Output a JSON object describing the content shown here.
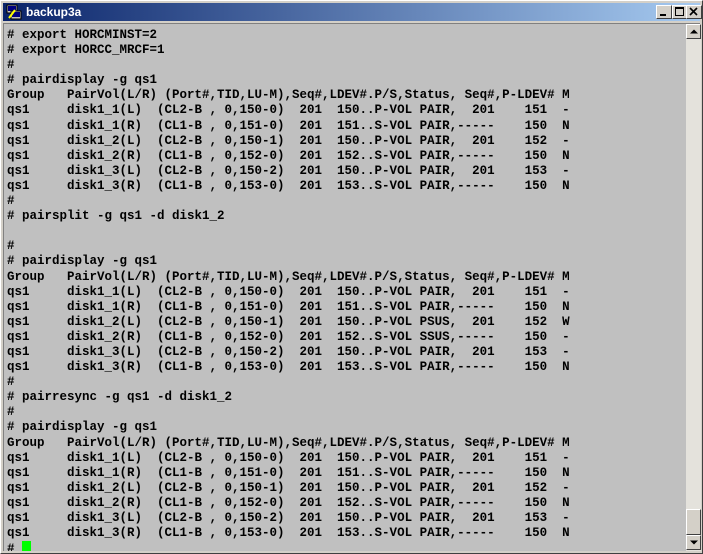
{
  "window": {
    "title": "backup3a",
    "app_icon": "putty-icon",
    "buttons": [
      "minimize-icon",
      "maximize-icon",
      "close-icon"
    ]
  },
  "terminal": {
    "background": "#c0c0c0",
    "foreground": "#000000",
    "cursor_color": "#00ff00",
    "lines": [
      "# export HORCMINST=2",
      "# export HORCC_MRCF=1",
      "#",
      "# pairdisplay -g qs1",
      "Group   PairVol(L/R) (Port#,TID,LU-M),Seq#,LDEV#.P/S,Status, Seq#,P-LDEV# M",
      "qs1     disk1_1(L)  (CL2-B , 0,150-0)  201  150..P-VOL PAIR,  201    151  -",
      "qs1     disk1_1(R)  (CL1-B , 0,151-0)  201  151..S-VOL PAIR,-----    150  N",
      "qs1     disk1_2(L)  (CL2-B , 0,150-1)  201  150..P-VOL PAIR,  201    152  -",
      "qs1     disk1_2(R)  (CL1-B , 0,152-0)  201  152..S-VOL PAIR,-----    150  N",
      "qs1     disk1_3(L)  (CL2-B , 0,150-2)  201  150..P-VOL PAIR,  201    153  -",
      "qs1     disk1_3(R)  (CL1-B , 0,153-0)  201  153..S-VOL PAIR,-----    150  N",
      "#",
      "# pairsplit -g qs1 -d disk1_2",
      "",
      "#",
      "# pairdisplay -g qs1",
      "Group   PairVol(L/R) (Port#,TID,LU-M),Seq#,LDEV#.P/S,Status, Seq#,P-LDEV# M",
      "qs1     disk1_1(L)  (CL2-B , 0,150-0)  201  150..P-VOL PAIR,  201    151  -",
      "qs1     disk1_1(R)  (CL1-B , 0,151-0)  201  151..S-VOL PAIR,-----    150  N",
      "qs1     disk1_2(L)  (CL2-B , 0,150-1)  201  150..P-VOL PSUS,  201    152  W",
      "qs1     disk1_2(R)  (CL1-B , 0,152-0)  201  152..S-VOL SSUS,-----    150  -",
      "qs1     disk1_3(L)  (CL2-B , 0,150-2)  201  150..P-VOL PAIR,  201    153  -",
      "qs1     disk1_3(R)  (CL1-B , 0,153-0)  201  153..S-VOL PAIR,-----    150  N",
      "#",
      "# pairresync -g qs1 -d disk1_2",
      "#",
      "# pairdisplay -g qs1",
      "Group   PairVol(L/R) (Port#,TID,LU-M),Seq#,LDEV#.P/S,Status, Seq#,P-LDEV# M",
      "qs1     disk1_1(L)  (CL2-B , 0,150-0)  201  150..P-VOL PAIR,  201    151  -",
      "qs1     disk1_1(R)  (CL1-B , 0,151-0)  201  151..S-VOL PAIR,-----    150  N",
      "qs1     disk1_2(L)  (CL2-B , 0,150-1)  201  150..P-VOL PAIR,  201    152  -",
      "qs1     disk1_2(R)  (CL1-B , 0,152-0)  201  152..S-VOL PAIR,-----    150  N",
      "qs1     disk1_3(L)  (CL2-B , 0,150-2)  201  150..P-VOL PAIR,  201    153  -",
      "qs1     disk1_3(R)  (CL1-B , 0,153-0)  201  153..S-VOL PAIR,-----    150  N"
    ],
    "prompt": "# "
  },
  "scrollbar": {
    "up_icon": "scroll-up-arrow-icon",
    "down_icon": "scroll-down-arrow-icon",
    "position": 0.97
  }
}
